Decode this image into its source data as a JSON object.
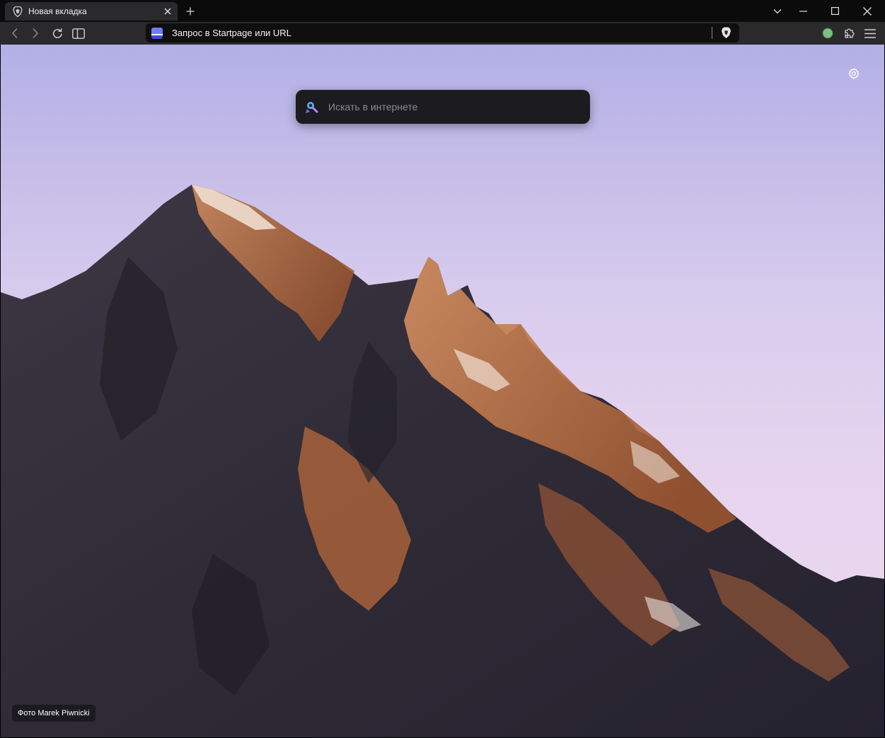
{
  "tab": {
    "title": "Новая вкладка",
    "favicon": "brave-lion-icon"
  },
  "toolbar": {
    "address_placeholder": "Запрос в Startpage или URL",
    "search_engine_icon": "startpage-icon"
  },
  "newtab_page": {
    "search_placeholder": "Искать в интернете",
    "photo_credit": "Фото Marek Piwnicki"
  },
  "colors": {
    "tabstrip": "#0b0b0c",
    "toolbar": "#2a2a2c",
    "urlbar": "#0f0f10",
    "profile_dot": "#7cc17e"
  }
}
